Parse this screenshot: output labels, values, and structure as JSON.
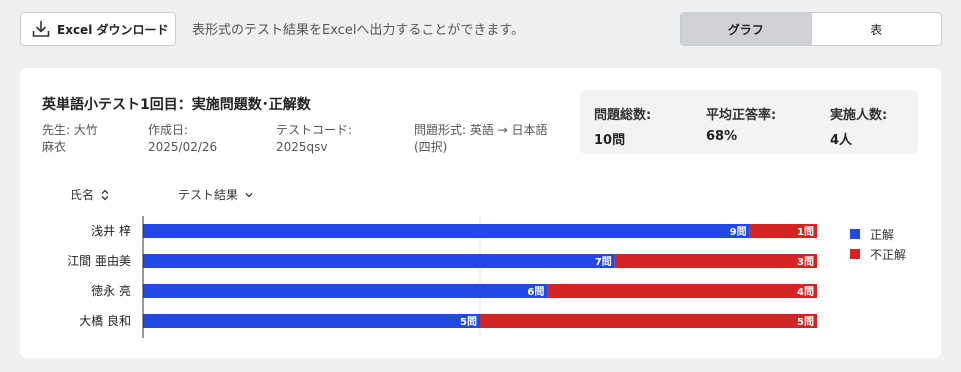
{
  "toolbar": {
    "excel_button_label": "Excel ダウンロード",
    "excel_description": "表形式のテスト結果をExcelへ出力することができます。",
    "view_toggle": {
      "graph_label": "グラフ",
      "table_label": "表",
      "selected": "グラフ"
    }
  },
  "card": {
    "title": "英単語小テスト1回目：実施問題数･正解数",
    "meta": {
      "teacher_line1": "先生: 大竹",
      "teacher_line2": "麻衣",
      "created_label": "作成日:",
      "created_value": "2025/02/26",
      "code_label": "テストコード:",
      "code_value": "2025qsv",
      "format_line1": "問題形式: 英語 → 日本語",
      "format_line2": "(四択)"
    },
    "stats": {
      "total_label": "問題総数:",
      "total_value": "10問",
      "avg_label": "平均正答率:",
      "avg_value": "68%",
      "count_label": "実施人数:",
      "count_value": "4人"
    },
    "columns": {
      "name_label": "氏名",
      "result_label": "テスト結果"
    }
  },
  "colors": {
    "correct": "#2448e6",
    "incorrect": "#d42424"
  },
  "chart_data": {
    "type": "bar",
    "orientation": "horizontal",
    "stacked": true,
    "categories": [
      "浅井 梓",
      "江間 亜由美",
      "徳永 亮",
      "大橋 良和"
    ],
    "series": [
      {
        "name": "正解",
        "values": [
          9,
          7,
          6,
          5
        ],
        "labels": [
          "9問",
          "7問",
          "6問",
          "5問"
        ],
        "color": "#2448e6"
      },
      {
        "name": "不正解",
        "values": [
          1,
          3,
          4,
          5
        ],
        "labels": [
          "1問",
          "3問",
          "4問",
          "5問"
        ],
        "color": "#d42424"
      }
    ],
    "xlim": [
      0,
      10
    ],
    "legend_position": "right"
  }
}
